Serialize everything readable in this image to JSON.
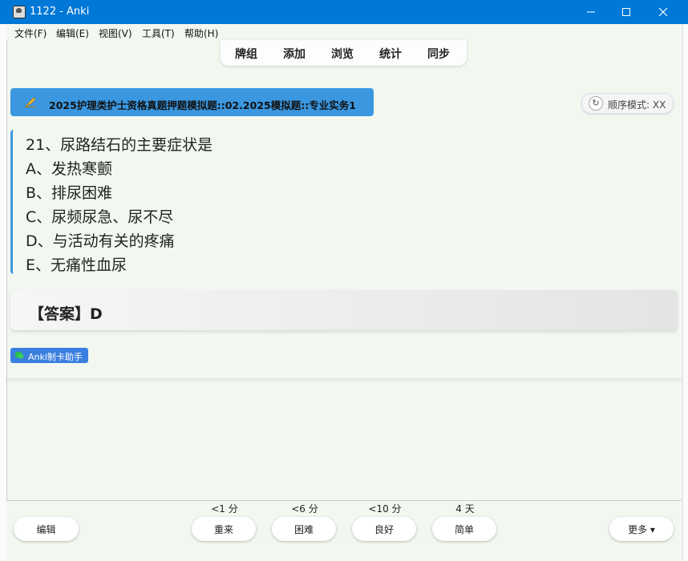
{
  "window": {
    "title": "1122 - Anki"
  },
  "menu": [
    "文件(F)",
    "编辑(E)",
    "视图(V)",
    "工具(T)",
    "帮助(H)"
  ],
  "topnav": [
    "牌组",
    "添加",
    "浏览",
    "统计",
    "同步"
  ],
  "deck": {
    "title": "2025护理类护士资格真题押题模拟题::02.2025模拟题::专业实务1"
  },
  "mode": {
    "label": "顺序模式: XX"
  },
  "question": {
    "stem": "21、尿路结石的主要症状是",
    "options": [
      "A、发热寒颤",
      "B、排尿困难",
      "C、尿频尿急、尿不尽",
      "D、与活动有关的疼痛",
      "E、无痛性血尿"
    ]
  },
  "answer": {
    "text": "【答案】D"
  },
  "tag": {
    "label": "Anki制卡助手"
  },
  "bottom": {
    "edit_label": "编辑",
    "more_label": "更多 ▾",
    "answers": [
      {
        "interval": "<1 分",
        "label": "重来"
      },
      {
        "interval": "<6 分",
        "label": "困难"
      },
      {
        "interval": "<10 分",
        "label": "良好"
      },
      {
        "interval": "4 天",
        "label": "简单"
      }
    ]
  },
  "colors": {
    "accent": "#3a97e0",
    "titlebar": "#0078d7",
    "background": "#f2f8f0",
    "tag": "#3a7fe0"
  }
}
